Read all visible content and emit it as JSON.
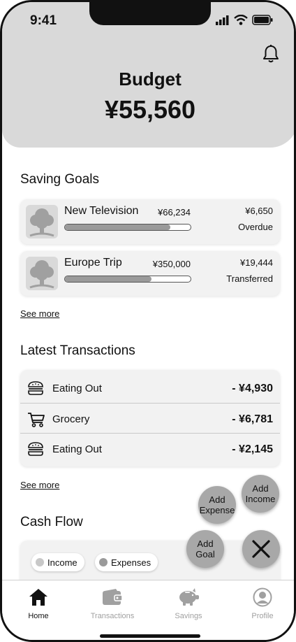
{
  "status_bar": {
    "time": "9:41"
  },
  "header": {
    "title": "Budget",
    "amount": "¥55,560"
  },
  "saving_goals": {
    "title": "Saving Goals",
    "goals": [
      {
        "name": "New Television",
        "target": "¥66,234",
        "saved": "¥6,650",
        "status": "Overdue",
        "progress_fraction": 0.84
      },
      {
        "name": "Europe Trip",
        "target": "¥350,000",
        "saved": "¥19,444",
        "status": "Transferred",
        "progress_fraction": 0.69
      }
    ],
    "see_more": "See more"
  },
  "transactions": {
    "title": "Latest Transactions",
    "items": [
      {
        "icon": "burger-icon",
        "label": "Eating Out",
        "amount": "- ¥4,930"
      },
      {
        "icon": "cart-icon",
        "label": "Grocery",
        "amount": "- ¥6,781"
      },
      {
        "icon": "burger-icon",
        "label": "Eating Out",
        "amount": "- ¥2,145"
      }
    ],
    "see_more": "See more"
  },
  "cash_flow": {
    "title": "Cash Flow",
    "legend": [
      {
        "label": "Income",
        "color": "#c8c8c8"
      },
      {
        "label": "Expenses",
        "color": "#9a9a9a"
      }
    ]
  },
  "fab_menu": {
    "add_income": [
      "Add",
      "Income"
    ],
    "add_expense": [
      "Add",
      "Expense"
    ],
    "add_goal": [
      "Add",
      "Goal"
    ],
    "close_icon": "close-icon"
  },
  "tab_bar": {
    "tabs": [
      {
        "label": "Home",
        "icon": "home-icon",
        "active": true
      },
      {
        "label": "Transactions",
        "icon": "wallet-icon",
        "active": false
      },
      {
        "label": "Savings",
        "icon": "piggy-bank-icon",
        "active": false
      },
      {
        "label": "Profile",
        "icon": "profile-icon",
        "active": false
      }
    ]
  },
  "colors": {
    "header_bg": "#d9d9d9",
    "card_bg": "#f2f2f2",
    "fab": "#a8a8a8",
    "inactive_tab": "#a0a0a0"
  }
}
